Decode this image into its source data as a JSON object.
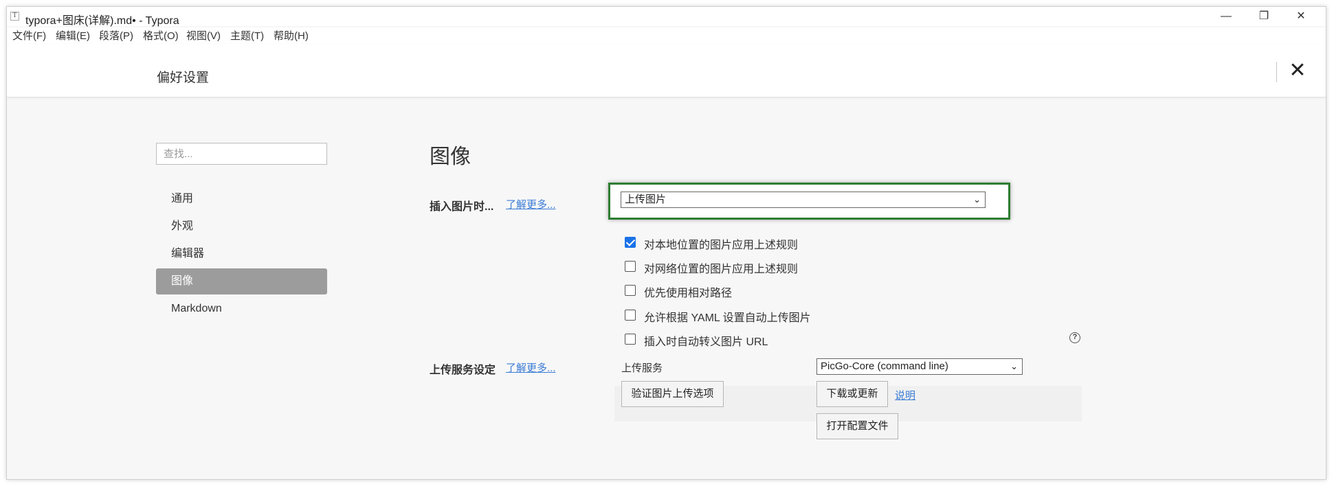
{
  "window": {
    "app_icon": "T",
    "title": "typora+图床(详解).md• - Typora",
    "controls": {
      "minimize": "—",
      "maximize": "❐",
      "close": "✕"
    }
  },
  "menu": [
    "文件(F)",
    "编辑(E)",
    "段落(P)",
    "格式(O)",
    "视图(V)",
    "主题(T)",
    "帮助(H)"
  ],
  "preferences": {
    "title": "偏好设置",
    "close_icon": "✕"
  },
  "sidebar": {
    "search_placeholder": "查找...",
    "items": [
      {
        "label": "通用",
        "active": false
      },
      {
        "label": "外观",
        "active": false
      },
      {
        "label": "编辑器",
        "active": false
      },
      {
        "label": "图像",
        "active": true
      },
      {
        "label": "Markdown",
        "active": false
      }
    ]
  },
  "image_section": {
    "title": "图像",
    "insert_label": "插入图片时...",
    "learn_more": "了解更多...",
    "insert_action": "上传图片",
    "checkboxes": [
      {
        "label": "对本地位置的图片应用上述规则",
        "checked": true
      },
      {
        "label": "对网络位置的图片应用上述规则",
        "checked": false
      },
      {
        "label": "优先使用相对路径",
        "checked": false
      },
      {
        "label": "允许根据 YAML 设置自动上传图片",
        "checked": false
      },
      {
        "label": "插入时自动转义图片 URL",
        "checked": false
      }
    ],
    "help_icon": "?"
  },
  "upload_section": {
    "label": "上传服务设定",
    "learn_more": "了解更多...",
    "service_label": "上传服务",
    "service_value": "PicGo-Core (command line)",
    "verify_button": "验证图片上传选项",
    "download_button": "下载或更新",
    "docs_link": "说明",
    "open_config_button": "打开配置文件"
  },
  "colors": {
    "highlight_border": "#2e7d32",
    "active_nav": "#9c9c9c",
    "link": "#3a7bd5",
    "checkbox_checked": "#1a73e8"
  }
}
